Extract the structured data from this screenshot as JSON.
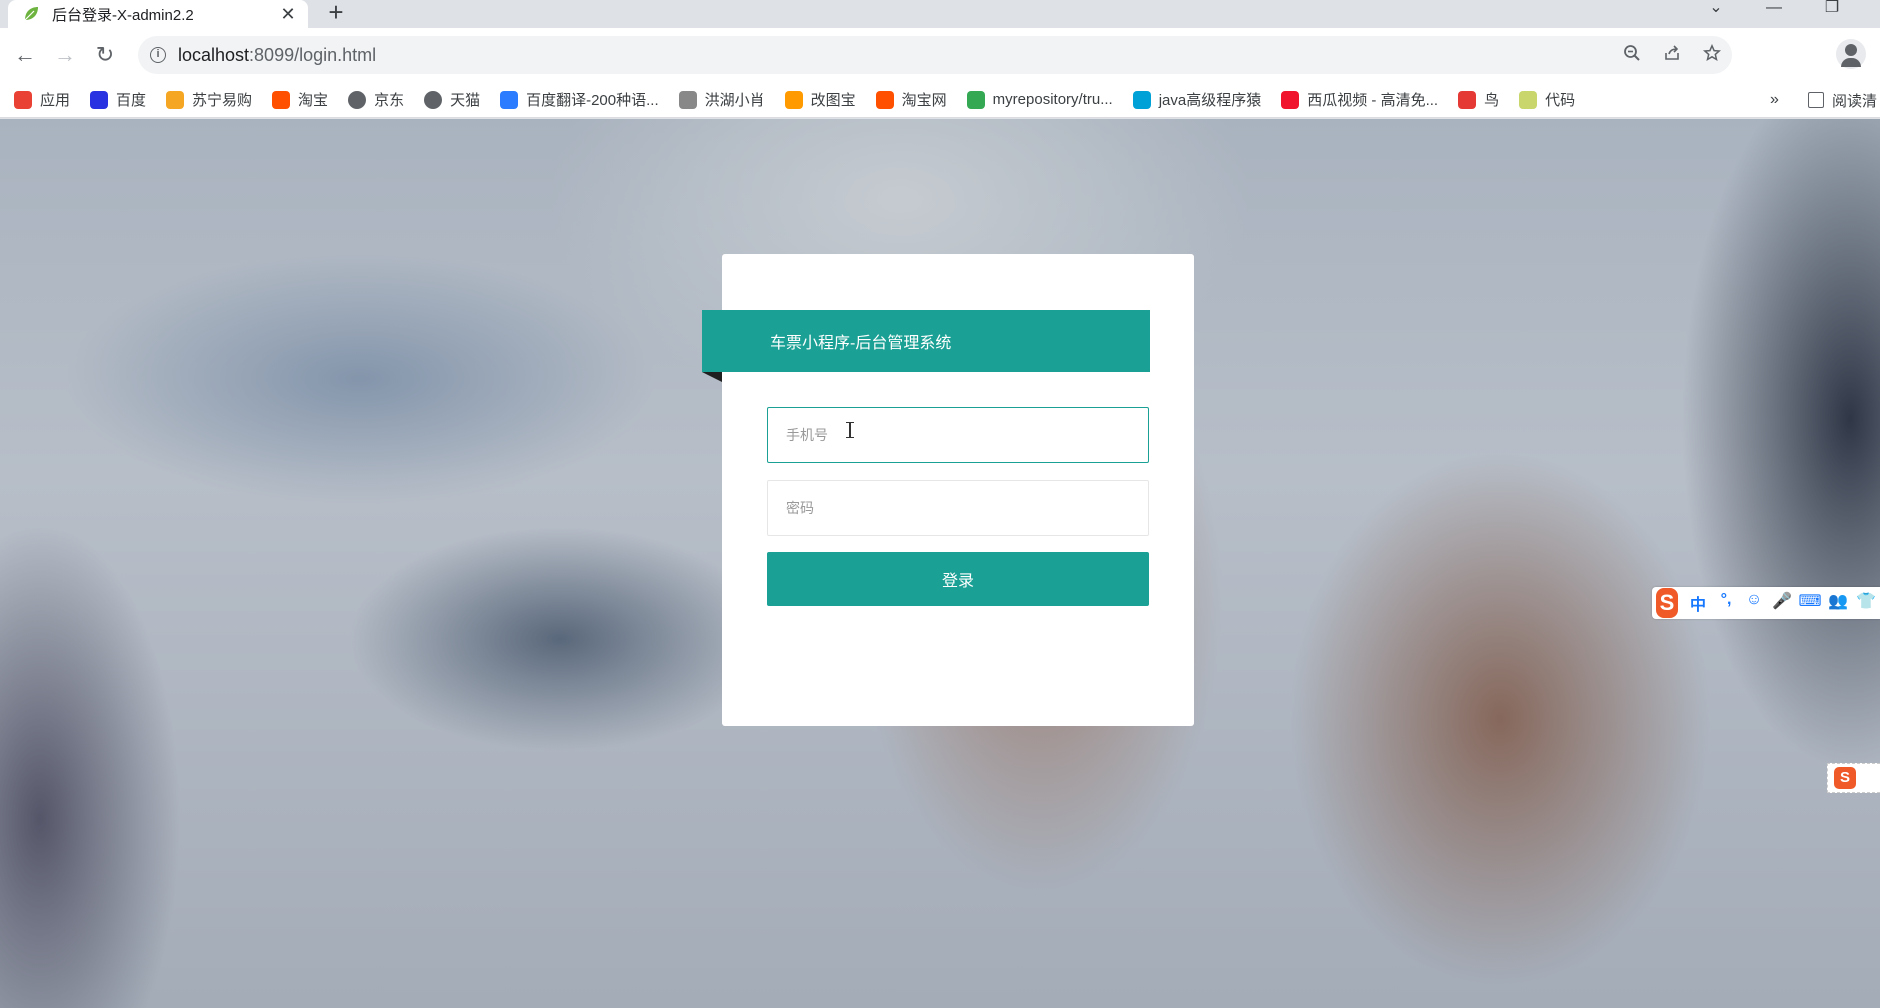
{
  "browser": {
    "tab": {
      "title": "后台登录-X-admin2.2",
      "close_glyph": "✕"
    },
    "new_tab_glyph": "+",
    "window_controls": {
      "dropdown": "⌄",
      "minimize": "—",
      "restore": "❐"
    },
    "nav": {
      "back": "←",
      "forward": "→",
      "reload": "↻"
    },
    "address": {
      "host": "localhost",
      "rest": ":8099/login.html"
    },
    "omnibox_icons": [
      "zoom-icon",
      "share-icon",
      "star-icon"
    ],
    "bookmarks": [
      {
        "label": "应用",
        "icon": "apps-grid-icon",
        "color": "#e94235"
      },
      {
        "label": "百度",
        "icon": "baidu-paw-icon",
        "color": "#2932e1"
      },
      {
        "label": "苏宁易购",
        "icon": "suning-lion-icon",
        "color": "#f5a623"
      },
      {
        "label": "淘宝",
        "icon": "taobao-icon",
        "color": "#ff5000"
      },
      {
        "label": "京东",
        "icon": "globe-icon",
        "color": "#5f6368"
      },
      {
        "label": "天猫",
        "icon": "globe-icon",
        "color": "#5f6368"
      },
      {
        "label": "百度翻译-200种语...",
        "icon": "translate-icon",
        "color": "#2b7cff"
      },
      {
        "label": "洪湖小肖",
        "icon": "bird-icon",
        "color": "#888888"
      },
      {
        "label": "改图宝",
        "icon": "gaitubao-icon",
        "color": "#ff9a00"
      },
      {
        "label": "淘宝网",
        "icon": "taobao-icon",
        "color": "#ff5000"
      },
      {
        "label": "myrepository/tru...",
        "icon": "chrome-icon",
        "color": "#34a853"
      },
      {
        "label": "java高级程序猿",
        "icon": "bilibili-icon",
        "color": "#00a1d6"
      },
      {
        "label": "西瓜视频 - 高清免...",
        "icon": "xigua-icon",
        "color": "#f0142c"
      },
      {
        "label": "鸟",
        "icon": "bird-red-icon",
        "color": "#e53935"
      },
      {
        "label": "代码",
        "icon": "leaf-icon",
        "color": "#c8d66b"
      }
    ],
    "bookmarks_more": "»",
    "reading_list": "阅读清"
  },
  "login": {
    "title": "车票小程序-后台管理系统",
    "phone_placeholder": "手机号",
    "password_placeholder": "密码",
    "submit_label": "登录",
    "accent_color": "#1aa094"
  },
  "ime": {
    "logo": "S",
    "items": [
      "中",
      "°,",
      "☺",
      "🎤",
      "⌨",
      "👥",
      "👕"
    ],
    "mini_logo": "S"
  }
}
